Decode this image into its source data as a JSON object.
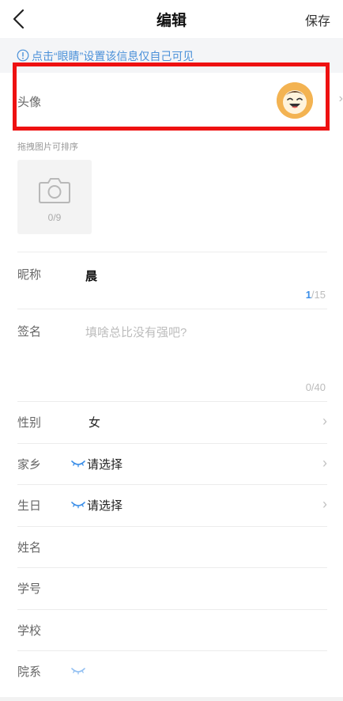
{
  "header": {
    "title": "编辑",
    "save_label": "保存"
  },
  "notice": {
    "text": "点击“眼睛”设置该信息仅自己可见"
  },
  "avatar": {
    "label": "头像",
    "chevron": "›"
  },
  "photos": {
    "hint": "拖拽图片可排序",
    "count": "0/9"
  },
  "nickname": {
    "label": "昵称",
    "value": "晨",
    "counter_current": "1",
    "counter_total": "/15"
  },
  "signature": {
    "label": "签名",
    "placeholder": "填啥总比没有强吧?",
    "counter": "0/40"
  },
  "fields": [
    {
      "label": "性别",
      "value": "女",
      "chevron": "›"
    },
    {
      "label": "家乡",
      "value": "请选择",
      "chevron": "›"
    },
    {
      "label": "生日",
      "value": "请选择",
      "chevron": "›"
    },
    {
      "label": "姓名",
      "value": ""
    },
    {
      "label": "学号",
      "value": ""
    },
    {
      "label": "学校",
      "value": ""
    },
    {
      "label": "院系",
      "value": ""
    }
  ],
  "colors": {
    "accent": "#4a90d9",
    "highlight": "#ee1111",
    "avatar_bg": "#f3b352"
  }
}
